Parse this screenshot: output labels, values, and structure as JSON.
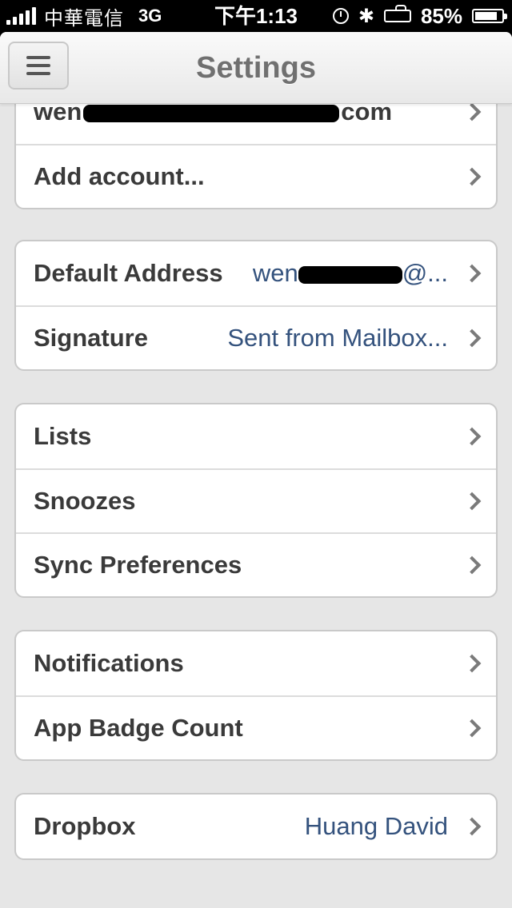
{
  "status_bar": {
    "carrier": "中華電信",
    "network": "3G",
    "time": "下午1:13",
    "battery": "85%",
    "battery_level": 0.85,
    "icons": [
      "signal-icon",
      "clock-icon",
      "bluetooth-icon",
      "orientation-lock-icon",
      "battery-icon"
    ]
  },
  "navbar": {
    "title": "Settings",
    "menu_icon": "menu-icon"
  },
  "accounts": {
    "partial_row_label": "wen",
    "partial_row_suffix": "com",
    "add_account_label": "Add account..."
  },
  "compose": {
    "default_address_label": "Default Address",
    "default_address_value_prefix": "wen",
    "default_address_value_suffix": "@...",
    "signature_label": "Signature",
    "signature_value": "Sent from Mailbox..."
  },
  "organize": {
    "items": [
      {
        "label": "Lists"
      },
      {
        "label": "Snoozes"
      },
      {
        "label": "Sync Preferences"
      }
    ]
  },
  "alerts": {
    "items": [
      {
        "label": "Notifications"
      },
      {
        "label": "App Badge Count"
      }
    ]
  },
  "integrations": {
    "dropbox_label": "Dropbox",
    "dropbox_value": "Huang David"
  },
  "colors": {
    "accent_value_text": "#34527d",
    "label_text": "#3a3a3a",
    "background": "#e6e6e6"
  }
}
